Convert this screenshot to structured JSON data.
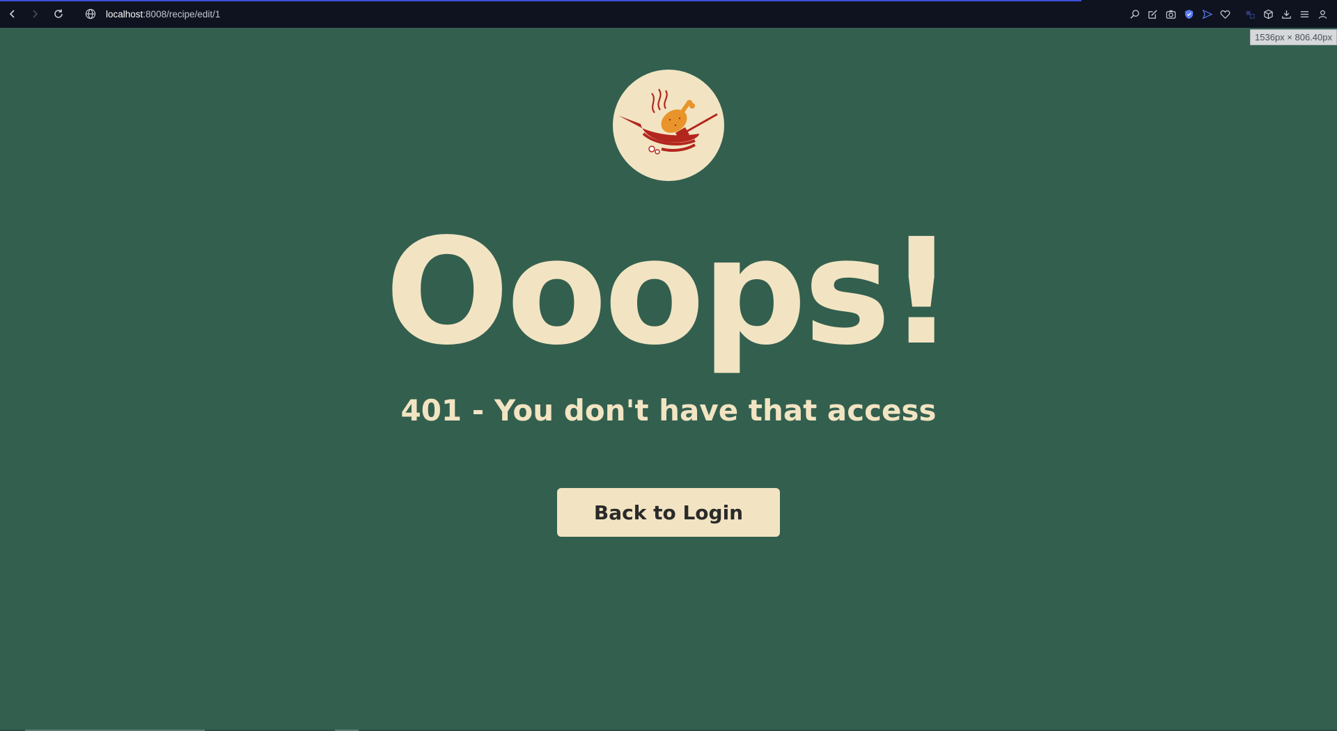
{
  "browser": {
    "url_host": "localhost",
    "url_path": ":8008/recipe/edit/1",
    "dims_badge": "1536px × 806.40px",
    "colors": {
      "toolbar_bg": "#0f1320",
      "accent": "#5b7cf2"
    },
    "icons": [
      "back-icon",
      "forward-icon",
      "reload-icon",
      "globe-icon",
      "zoom-icon",
      "edit-icon",
      "camera-icon",
      "shield-icon",
      "send-icon",
      "heart-icon",
      "translate-icon",
      "cube-icon",
      "download-icon",
      "menu-icon",
      "profile-icon"
    ]
  },
  "page": {
    "headline": "Ooops!",
    "subheadline": "401 - You don't have that access",
    "button_label": "Back to Login",
    "logo_icon": "chicken-wok-logo-icon",
    "colors": {
      "background": "#335f4f",
      "cream": "#f2e4c2",
      "logo_red": "#b3261e",
      "logo_orange": "#e8942a"
    }
  }
}
